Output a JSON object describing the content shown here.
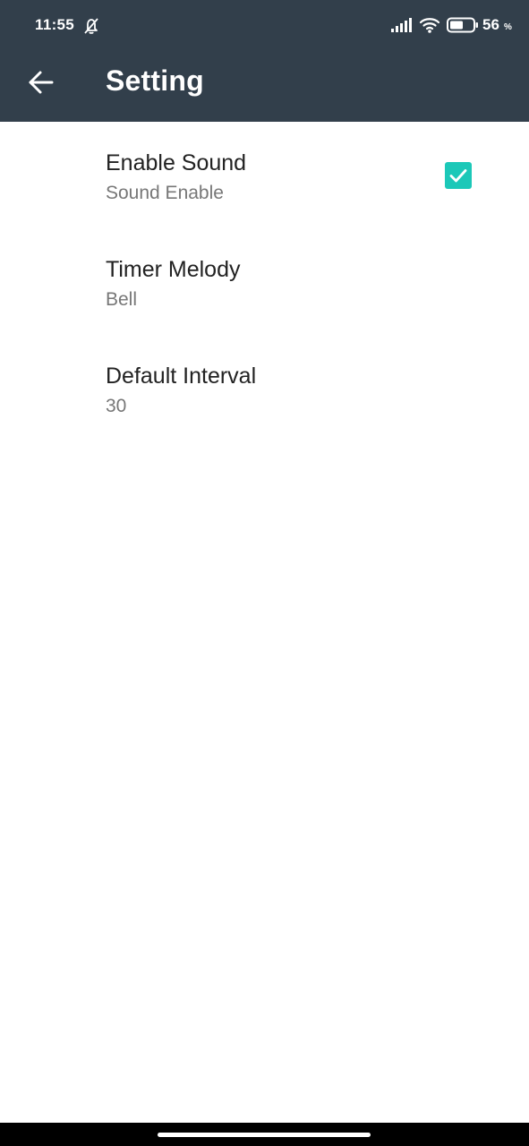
{
  "status_bar": {
    "time": "11:55",
    "battery_level": "56",
    "battery_unit": "%",
    "icons": [
      "alarm-off-icon",
      "signal-icon",
      "wifi-icon",
      "battery-icon"
    ]
  },
  "app_bar": {
    "title": "Setting",
    "back_icon": "arrow-left-icon",
    "background_color": "#323f4b"
  },
  "settings": [
    {
      "title": "Enable Sound",
      "summary": "Sound Enable",
      "checked": true
    },
    {
      "title": "Timer Melody",
      "summary": "Bell"
    },
    {
      "title": "Default Interval",
      "summary": "30"
    }
  ],
  "colors": {
    "accent": "#1cc8b8",
    "title_text": "#222222",
    "summary_text": "#777777"
  }
}
